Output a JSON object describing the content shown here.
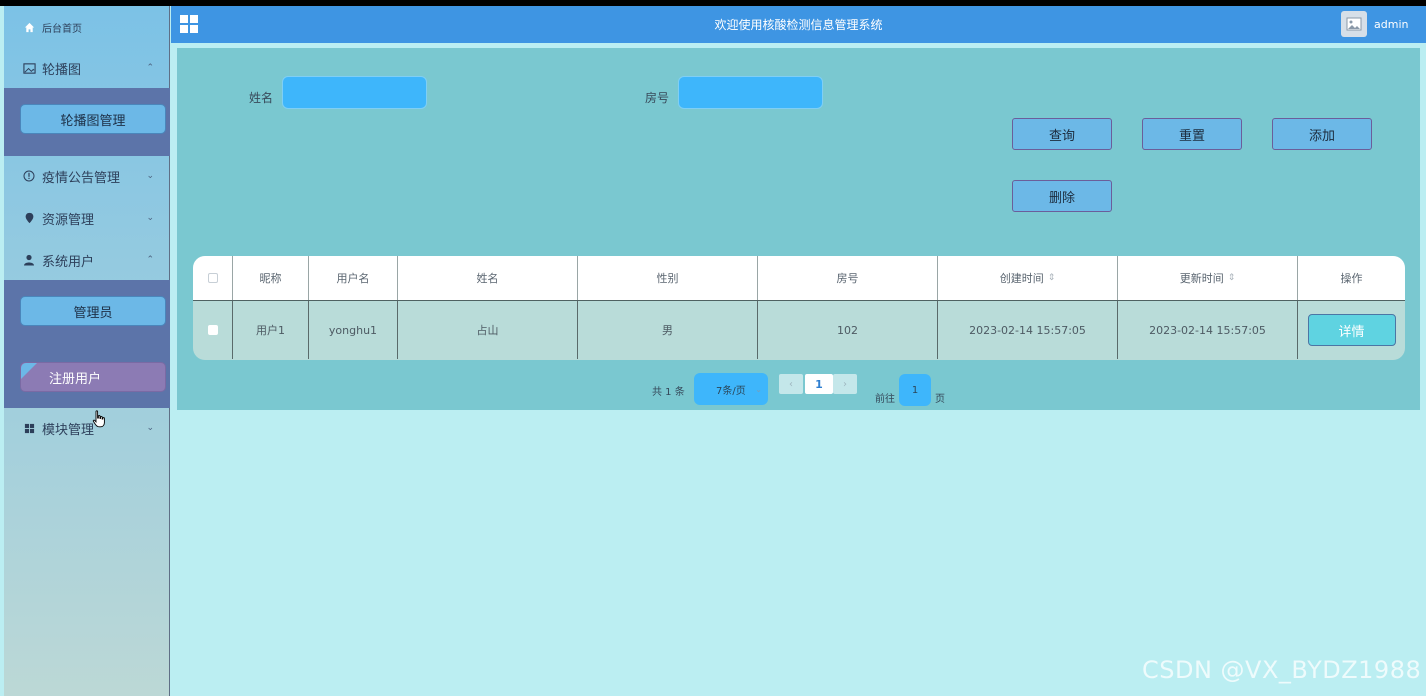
{
  "header": {
    "title": "欢迎使用核酸检测信息管理系统",
    "user": "admin"
  },
  "sidebar": {
    "home": "后台首页",
    "menus": [
      {
        "label": "轮播图",
        "icon": "image-icon",
        "expanded": true,
        "children": [
          "轮播图管理"
        ]
      },
      {
        "label": "疫情公告管理",
        "icon": "info-circle-icon",
        "expanded": false
      },
      {
        "label": "资源管理",
        "icon": "location-icon",
        "expanded": false
      },
      {
        "label": "系统用户",
        "icon": "user-icon",
        "expanded": true,
        "children": [
          "管理员",
          "注册用户"
        ]
      },
      {
        "label": "模块管理",
        "icon": "grid-icon",
        "expanded": false
      }
    ]
  },
  "search": {
    "name_label": "姓名",
    "name_value": "",
    "name_placeholder": "",
    "room_label": "房号",
    "room_value": "",
    "room_placeholder": ""
  },
  "buttons": {
    "query": "查询",
    "reset": "重置",
    "add": "添加",
    "delete": "删除"
  },
  "table": {
    "headers": [
      "昵称",
      "用户名",
      "姓名",
      "性别",
      "房号",
      "创建时间",
      "更新时间",
      "操作"
    ],
    "rows": [
      {
        "nickname": "用户1",
        "username": "yonghu1",
        "name": "占山",
        "gender": "男",
        "room": "102",
        "created": "2023-02-14 15:57:05",
        "updated": "2023-02-14 15:57:05",
        "action": "详情"
      }
    ]
  },
  "pagination": {
    "total_text": "共 1 条",
    "page_size": "7条/页",
    "current_page": "1",
    "goto_label": "前往",
    "goto_value": "1",
    "page_suffix": "页"
  },
  "watermark": "CSDN @VX_BYDZ1988",
  "colors": {
    "header": "#3e95e3",
    "panel": "#7ac8d0",
    "input": "#3eb6fb",
    "button": "#6cb8e7",
    "submenu": "#5c74a9"
  }
}
